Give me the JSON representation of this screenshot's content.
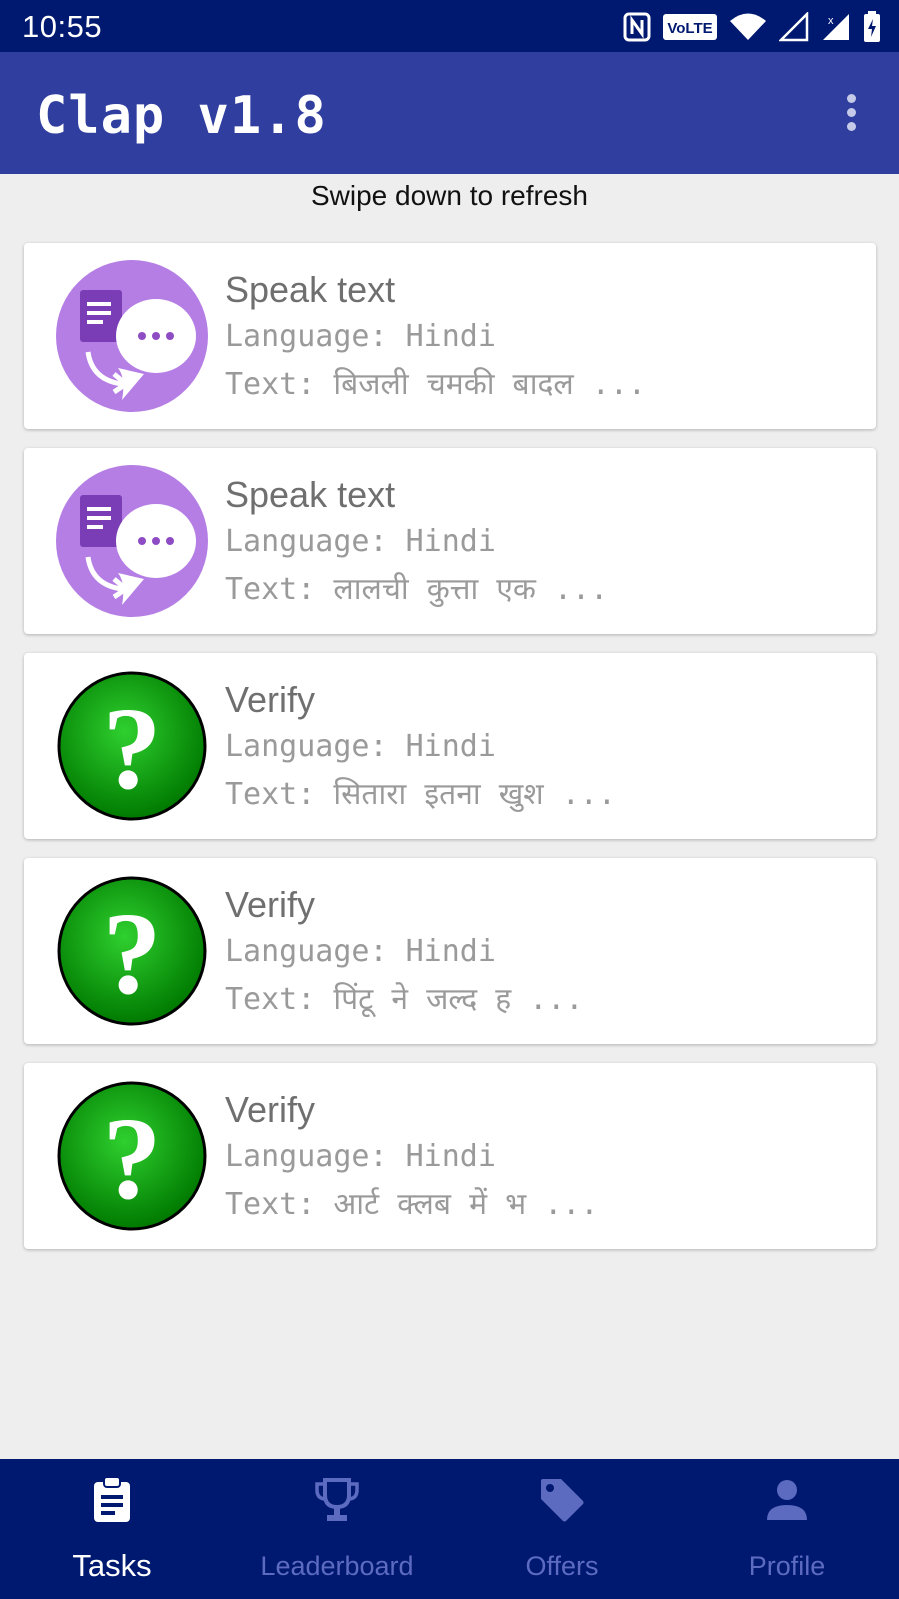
{
  "status_bar": {
    "time": "10:55",
    "volte_label": "VoLTE",
    "icons": [
      "nfc-icon",
      "volte-icon",
      "wifi-icon",
      "signal-icon",
      "signal-icon",
      "battery-charging-icon"
    ]
  },
  "app_bar": {
    "title": "Clap v1.8",
    "menu_icon": "more-vert-icon"
  },
  "refresh_hint": "Swipe down to refresh",
  "tasks": [
    {
      "type": "speak",
      "title": "Speak text",
      "language": "Language: Hindi",
      "text": "Text: बिजली चमकी बादल ..."
    },
    {
      "type": "speak",
      "title": "Speak text",
      "language": "Language: Hindi",
      "text": "Text: लालची कुत्ता एक ..."
    },
    {
      "type": "verify",
      "title": "Verify",
      "language": "Language: Hindi",
      "text": "Text: सितारा इतना खुश ..."
    },
    {
      "type": "verify",
      "title": "Verify",
      "language": "Language: Hindi",
      "text": "Text: पिंटू ने जल्द ह ..."
    },
    {
      "type": "verify",
      "title": "Verify",
      "language": "Language: Hindi",
      "text": "Text: आर्ट क्लब में भ ..."
    }
  ],
  "bottom_nav": {
    "items": [
      {
        "label": "Tasks",
        "icon": "clipboard-icon",
        "active": true
      },
      {
        "label": "Leaderboard",
        "icon": "trophy-icon",
        "active": false
      },
      {
        "label": "Offers",
        "icon": "tag-icon",
        "active": false
      },
      {
        "label": "Profile",
        "icon": "person-icon",
        "active": false
      }
    ]
  },
  "colors": {
    "status_bar": "#001970",
    "app_bar": "#303f9f",
    "nav_inactive": "#5c6bc0",
    "speak_icon": "#b57ee5",
    "verify_icon": "#0a9a0a"
  }
}
